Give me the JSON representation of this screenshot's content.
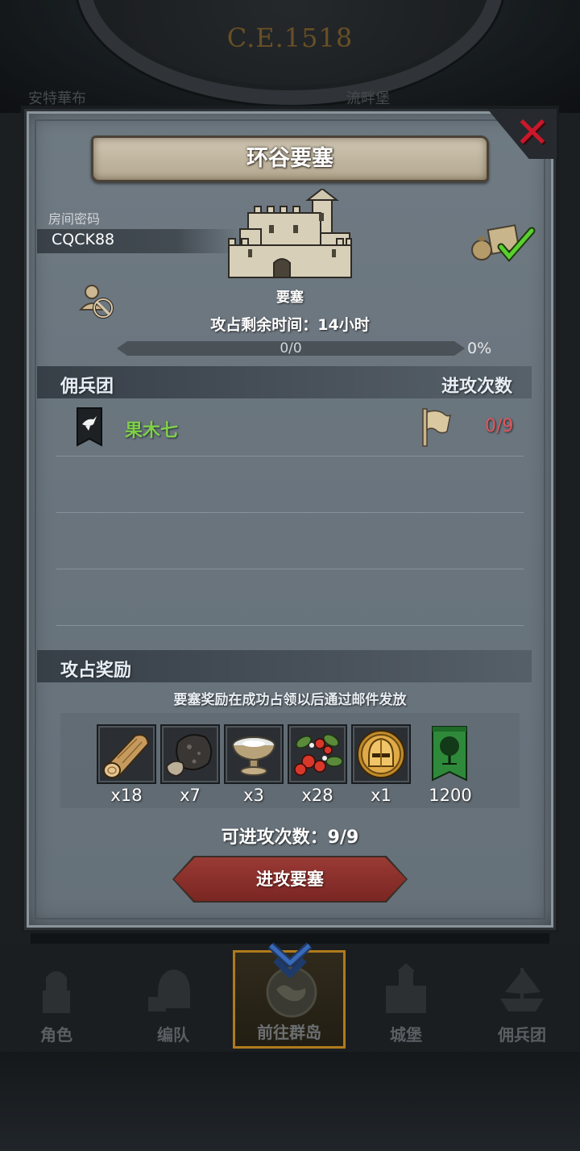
{
  "background": {
    "era": "C.E.1518",
    "left_label": "安特華布",
    "right_label": "流畔堡"
  },
  "dialog": {
    "title": "环谷要塞",
    "close_icon": "close-x-icon",
    "room": {
      "label": "房间密码",
      "code": "CQCK88"
    },
    "fortress": {
      "label": "要塞",
      "time_remaining": "攻占剩余时间：14小时",
      "progress_text": "0/0",
      "progress_percent": "0%",
      "progress_fraction": 0
    },
    "mercenary_section": {
      "title": "佣兵团",
      "attacks_header": "进攻次数",
      "rows": [
        {
          "name": "果木七",
          "attacks": "0/9"
        }
      ]
    },
    "reward_section": {
      "title": "攻占奖励",
      "note": "要塞奖励在成功占领以后通过邮件发放",
      "items": [
        {
          "icon": "wood-log-icon",
          "count": "x18"
        },
        {
          "icon": "ore-rock-icon",
          "count": "x7"
        },
        {
          "icon": "salt-bowl-icon",
          "count": "x3"
        },
        {
          "icon": "berries-icon",
          "count": "x28"
        },
        {
          "icon": "golden-helmet-icon",
          "count": "x1"
        },
        {
          "icon": "tree-banner-icon",
          "count": "1200"
        }
      ]
    },
    "attacks_left": "可进攻次数：9/9",
    "attack_button": "进攻要塞"
  },
  "nav": {
    "items": [
      {
        "label": "角色",
        "icon": "knight-icon"
      },
      {
        "label": "编队",
        "icon": "helmet-icon"
      },
      {
        "label": "前往群岛",
        "icon": "world-map-icon",
        "active": true
      },
      {
        "label": "城堡",
        "icon": "castle-icon"
      },
      {
        "label": "佣兵团",
        "icon": "ship-icon"
      }
    ]
  },
  "colors": {
    "accent_red": "#c8182a",
    "member_green": "#7fd04a",
    "attack_count_red": "#e0575e",
    "active_nav_gold": "#b07a1c"
  }
}
